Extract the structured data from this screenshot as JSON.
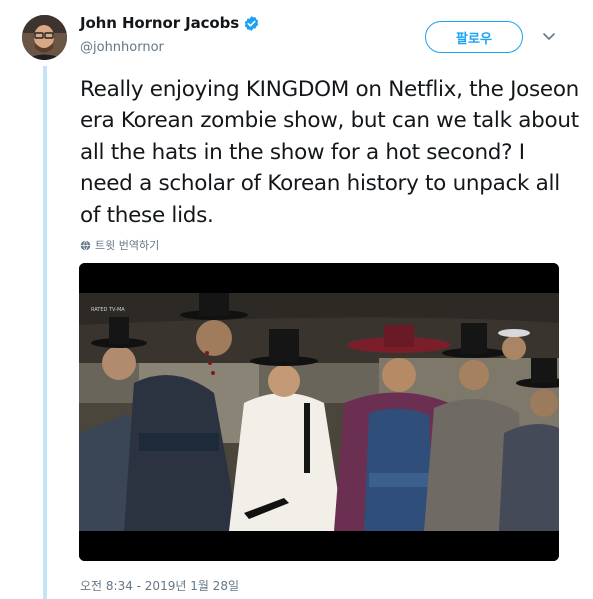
{
  "author": {
    "display_name": "John Hornor Jacobs",
    "handle": "@johnhornor",
    "avatar_icon": "avatar-photo",
    "verified_icon": "verified-badge-icon"
  },
  "actions": {
    "follow_label": "팔로우",
    "more_icon": "chevron-down-icon"
  },
  "tweet": {
    "text": "Really enjoying KINGDOM on Netflix, the Joseon era Korean zombie show, but can we talk about all the hats in the show for a hot second? I need a scholar of Korean history to unpack all of these lids.",
    "translate_label": "트윗 번역하기",
    "translate_icon": "globe-icon",
    "media_overlay": "RATED TV-MA",
    "timestamp": "오전 8:34 - 2019년 1월 28일"
  },
  "colors": {
    "accent": "#1da1f2",
    "secondary_text": "#657786",
    "thread_line": "#c4e4f7"
  }
}
